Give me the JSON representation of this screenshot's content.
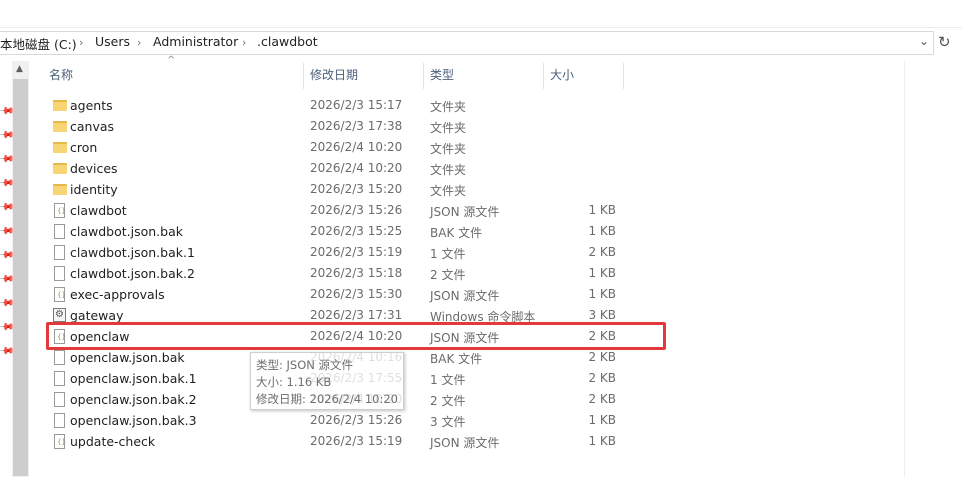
{
  "address": {
    "crumbs": [
      "本地磁盘 (C:)",
      "Users",
      "Administrator",
      ".clawdbot"
    ],
    "separator": "›",
    "dropdown_icon": "chevron-down-icon",
    "refresh_icon": "refresh-icon"
  },
  "columns": {
    "name": "名称",
    "date": "修改日期",
    "type": "类型",
    "size": "大小"
  },
  "files": [
    {
      "name": "agents",
      "date": "2026/2/3 15:17",
      "type": "文件夹",
      "size": "",
      "icon": "folder-icon"
    },
    {
      "name": "canvas",
      "date": "2026/2/3 17:38",
      "type": "文件夹",
      "size": "",
      "icon": "folder-icon"
    },
    {
      "name": "cron",
      "date": "2026/2/4 10:20",
      "type": "文件夹",
      "size": "",
      "icon": "folder-icon"
    },
    {
      "name": "devices",
      "date": "2026/2/4 10:20",
      "type": "文件夹",
      "size": "",
      "icon": "folder-icon"
    },
    {
      "name": "identity",
      "date": "2026/2/3 15:20",
      "type": "文件夹",
      "size": "",
      "icon": "folder-icon"
    },
    {
      "name": "clawdbot",
      "date": "2026/2/3 15:26",
      "type": "JSON 源文件",
      "size": "1 KB",
      "icon": "json-file-icon"
    },
    {
      "name": "clawdbot.json.bak",
      "date": "2026/2/3 15:25",
      "type": "BAK 文件",
      "size": "1 KB",
      "icon": "file-icon"
    },
    {
      "name": "clawdbot.json.bak.1",
      "date": "2026/2/3 15:19",
      "type": "1 文件",
      "size": "2 KB",
      "icon": "file-icon"
    },
    {
      "name": "clawdbot.json.bak.2",
      "date": "2026/2/3 15:18",
      "type": "2 文件",
      "size": "1 KB",
      "icon": "file-icon"
    },
    {
      "name": "exec-approvals",
      "date": "2026/2/3 15:30",
      "type": "JSON 源文件",
      "size": "1 KB",
      "icon": "json-file-icon"
    },
    {
      "name": "gateway",
      "date": "2026/2/3 17:31",
      "type": "Windows 命令脚本",
      "size": "3 KB",
      "icon": "batch-file-icon"
    },
    {
      "name": "openclaw",
      "date": "2026/2/4 10:20",
      "type": "JSON 源文件",
      "size": "2 KB",
      "icon": "json-file-icon"
    },
    {
      "name": "openclaw.json.bak",
      "date": "2026/2/4 10:16",
      "type": "BAK 文件",
      "size": "2 KB",
      "icon": "file-icon"
    },
    {
      "name": "openclaw.json.bak.1",
      "date": "2026/2/3 17:55",
      "type": "1 文件",
      "size": "2 KB",
      "icon": "file-icon"
    },
    {
      "name": "openclaw.json.bak.2",
      "date": "2026/2/4 10:20",
      "type": "2 文件",
      "size": "2 KB",
      "icon": "file-icon"
    },
    {
      "name": "openclaw.json.bak.3",
      "date": "2026/2/3 15:26",
      "type": "3 文件",
      "size": "1 KB",
      "icon": "file-icon"
    },
    {
      "name": "update-check",
      "date": "2026/2/3 15:19",
      "type": "JSON 源文件",
      "size": "1 KB",
      "icon": "json-file-icon"
    }
  ],
  "highlighted_file": "openclaw",
  "tooltip": {
    "type_line": "类型: JSON 源文件",
    "size_line": "大小: 1.16 KB",
    "date_line": "修改日期: 2026/2/4 10:20"
  },
  "colors": {
    "highlight_border": "#e5383b",
    "folder": "#f8d574",
    "header_text": "#4c607a"
  }
}
